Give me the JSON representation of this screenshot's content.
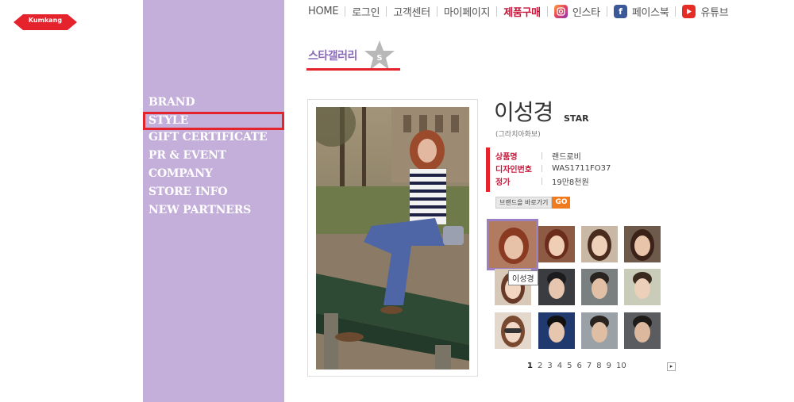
{
  "brand": {
    "logo_text": "Kumkang",
    "logo_color": "#e4232d"
  },
  "sidebar": {
    "bg_color": "#c3afd9",
    "items": [
      {
        "label": "BRAND"
      },
      {
        "label": "STYLE",
        "active": true
      },
      {
        "label": "GIFT CERTIFICATE"
      },
      {
        "label": "PR & EVENT"
      },
      {
        "label": "COMPANY"
      },
      {
        "label": "STORE INFO"
      },
      {
        "label": "NEW PARTNERS"
      }
    ]
  },
  "topnav": {
    "home": "HOME",
    "login": "로그인",
    "support": "고객센터",
    "mypage": "마이페이지",
    "shop": "제품구매",
    "instagram": "인스타",
    "facebook": "페이스북",
    "youtube": "유튜브"
  },
  "section": {
    "title": "스타갤러리",
    "badge": "S"
  },
  "star": {
    "name": "이성경",
    "tag": "STAR",
    "subtitle": "(그라치아화보)",
    "info": [
      {
        "key": "상품명",
        "value": "랜드로비"
      },
      {
        "key": "디자인번호",
        "value": "WAS1711FO37"
      },
      {
        "key": "정가",
        "value": "19만8천원"
      }
    ],
    "brand_link_label": "브랜드을 바로가기",
    "go_label": "GO"
  },
  "thumbs": {
    "tooltip": "이성경"
  },
  "pager": {
    "pages": [
      "1",
      "2",
      "3",
      "4",
      "5",
      "6",
      "7",
      "8",
      "9",
      "10"
    ],
    "current": "1",
    "next": "▸"
  },
  "colors": {
    "accent_red": "#e4232d",
    "accent_purple": "#8a6cb8",
    "go_orange": "#f07b1f"
  }
}
